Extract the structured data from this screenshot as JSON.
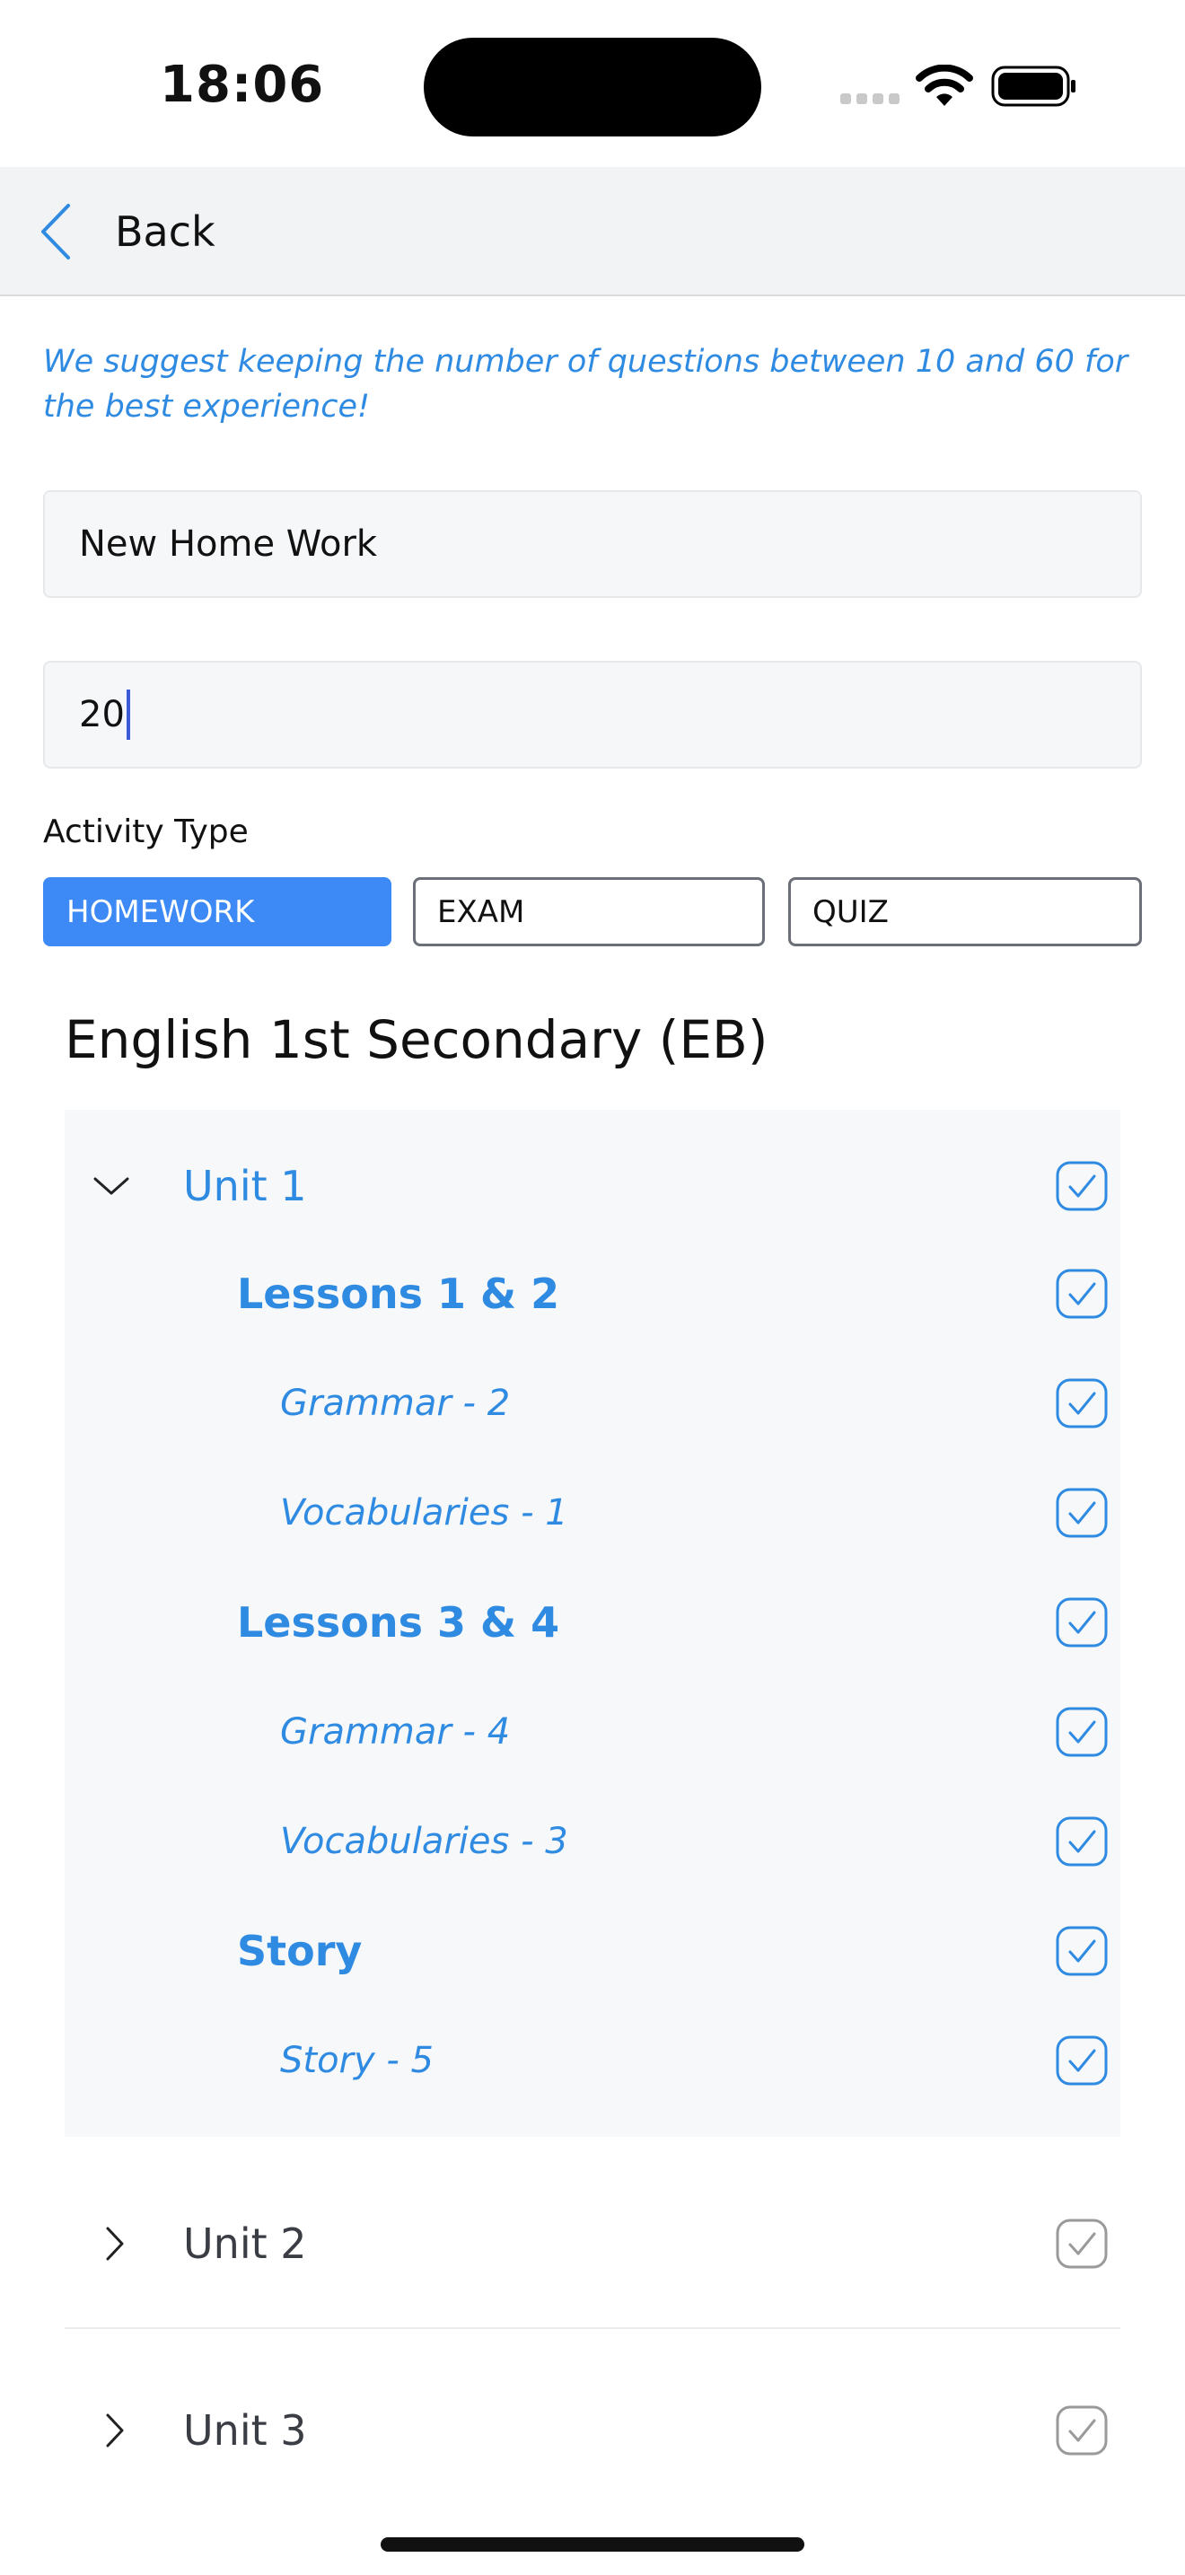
{
  "status_bar": {
    "time": "18:06",
    "icons": [
      "signal-icon",
      "wifi-icon",
      "battery-icon"
    ]
  },
  "nav": {
    "back_label": "Back",
    "back_icon": "chevron-left-icon"
  },
  "hint": "We suggest keeping the number of questions between 10 and 60 for the best experience!",
  "form": {
    "title_value": "New Home Work",
    "count_value": "20",
    "activity_label": "Activity Type",
    "activity_options": [
      {
        "label": "HOMEWORK",
        "selected": true
      },
      {
        "label": "EXAM",
        "selected": false
      },
      {
        "label": "QUIZ",
        "selected": false
      }
    ]
  },
  "course": {
    "title": "English 1st Secondary (EB)",
    "expanded_unit": {
      "label": "Unit 1",
      "checked": true,
      "children": [
        {
          "label": "Lessons 1 & 2",
          "type": "lesson",
          "checked": true
        },
        {
          "label": "Grammar - 2",
          "type": "item",
          "checked": true
        },
        {
          "label": "Vocabularies - 1",
          "type": "item",
          "checked": true
        },
        {
          "label": "Lessons 3 & 4",
          "type": "lesson",
          "checked": true
        },
        {
          "label": "Grammar - 4",
          "type": "item",
          "checked": true
        },
        {
          "label": "Vocabularies - 3",
          "type": "item",
          "checked": true
        },
        {
          "label": "Story",
          "type": "lesson",
          "checked": true
        },
        {
          "label": "Story - 5",
          "type": "item",
          "checked": true
        }
      ]
    },
    "collapsed_units": [
      {
        "label": "Unit 2",
        "checked": false
      },
      {
        "label": "Unit 3",
        "checked": false
      }
    ]
  },
  "colors": {
    "accent": "#2f8ae2",
    "selected_segment": "#3d8af7",
    "panel_bg": "#f6f8fa",
    "unchecked": "#9a9a9a"
  }
}
